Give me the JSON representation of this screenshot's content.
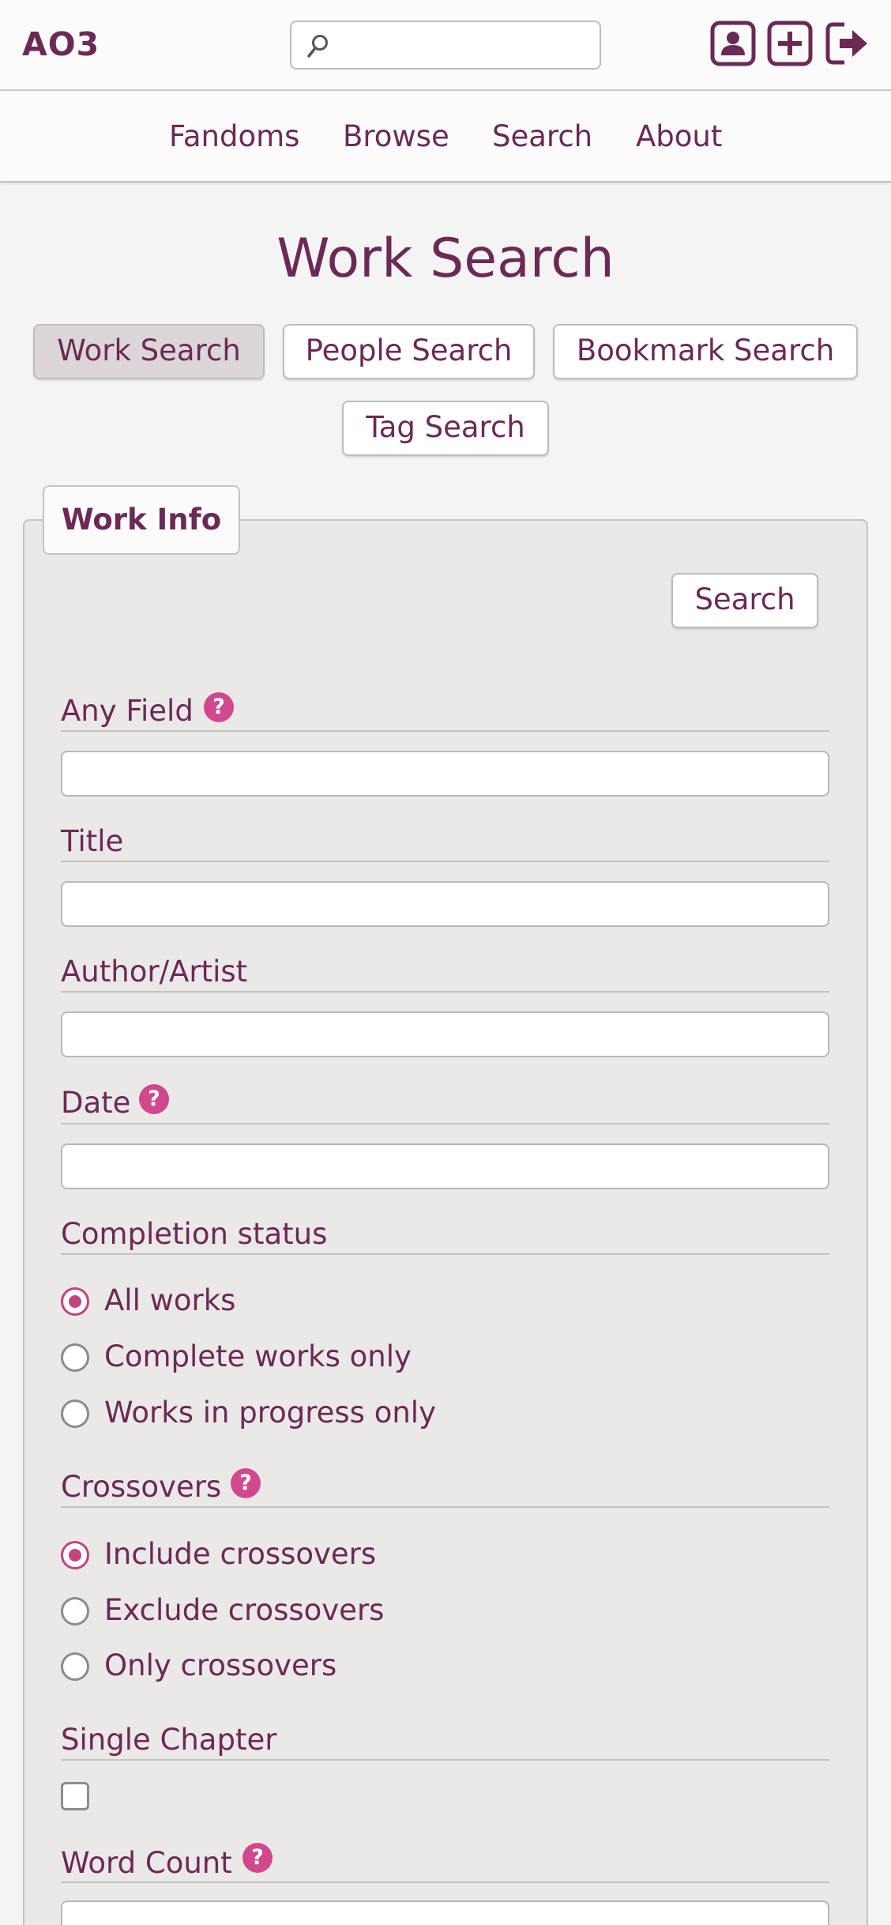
{
  "header": {
    "logo": "AO3",
    "search": {
      "placeholder": "",
      "value": ""
    },
    "icons": [
      "user-icon",
      "add-icon",
      "logout-icon"
    ]
  },
  "nav": {
    "items": [
      {
        "label": "Fandoms"
      },
      {
        "label": "Browse"
      },
      {
        "label": "Search"
      },
      {
        "label": "About"
      }
    ]
  },
  "page": {
    "title": "Work Search",
    "tabs": [
      {
        "label": "Work Search",
        "active": true
      },
      {
        "label": "People Search",
        "active": false
      },
      {
        "label": "Bookmark Search",
        "active": false
      },
      {
        "label": "Tag Search",
        "active": false
      }
    ]
  },
  "form": {
    "legend": "Work Info",
    "search_button": "Search",
    "help_glyph": "?",
    "fields": {
      "any_field": {
        "label": "Any Field",
        "value": ""
      },
      "title": {
        "label": "Title",
        "value": ""
      },
      "author": {
        "label": "Author/Artist",
        "value": ""
      },
      "date": {
        "label": "Date",
        "value": ""
      },
      "word_count": {
        "label": "Word Count",
        "value": ""
      }
    },
    "completion": {
      "label": "Completion status",
      "options": [
        {
          "label": "All works",
          "checked": true
        },
        {
          "label": "Complete works only",
          "checked": false
        },
        {
          "label": "Works in progress only",
          "checked": false
        }
      ]
    },
    "crossovers": {
      "label": "Crossovers",
      "options": [
        {
          "label": "Include crossovers",
          "checked": true
        },
        {
          "label": "Exclude crossovers",
          "checked": false
        },
        {
          "label": "Only crossovers",
          "checked": false
        }
      ]
    },
    "single_chapter": {
      "label": "Single Chapter",
      "checked": false
    }
  },
  "colors": {
    "accent": "#6b2a55",
    "help_badge": "#d0488d",
    "radio_checked": "#c2447f",
    "background": "#f5f4f4",
    "fieldset_background": "#ebe8e8"
  }
}
